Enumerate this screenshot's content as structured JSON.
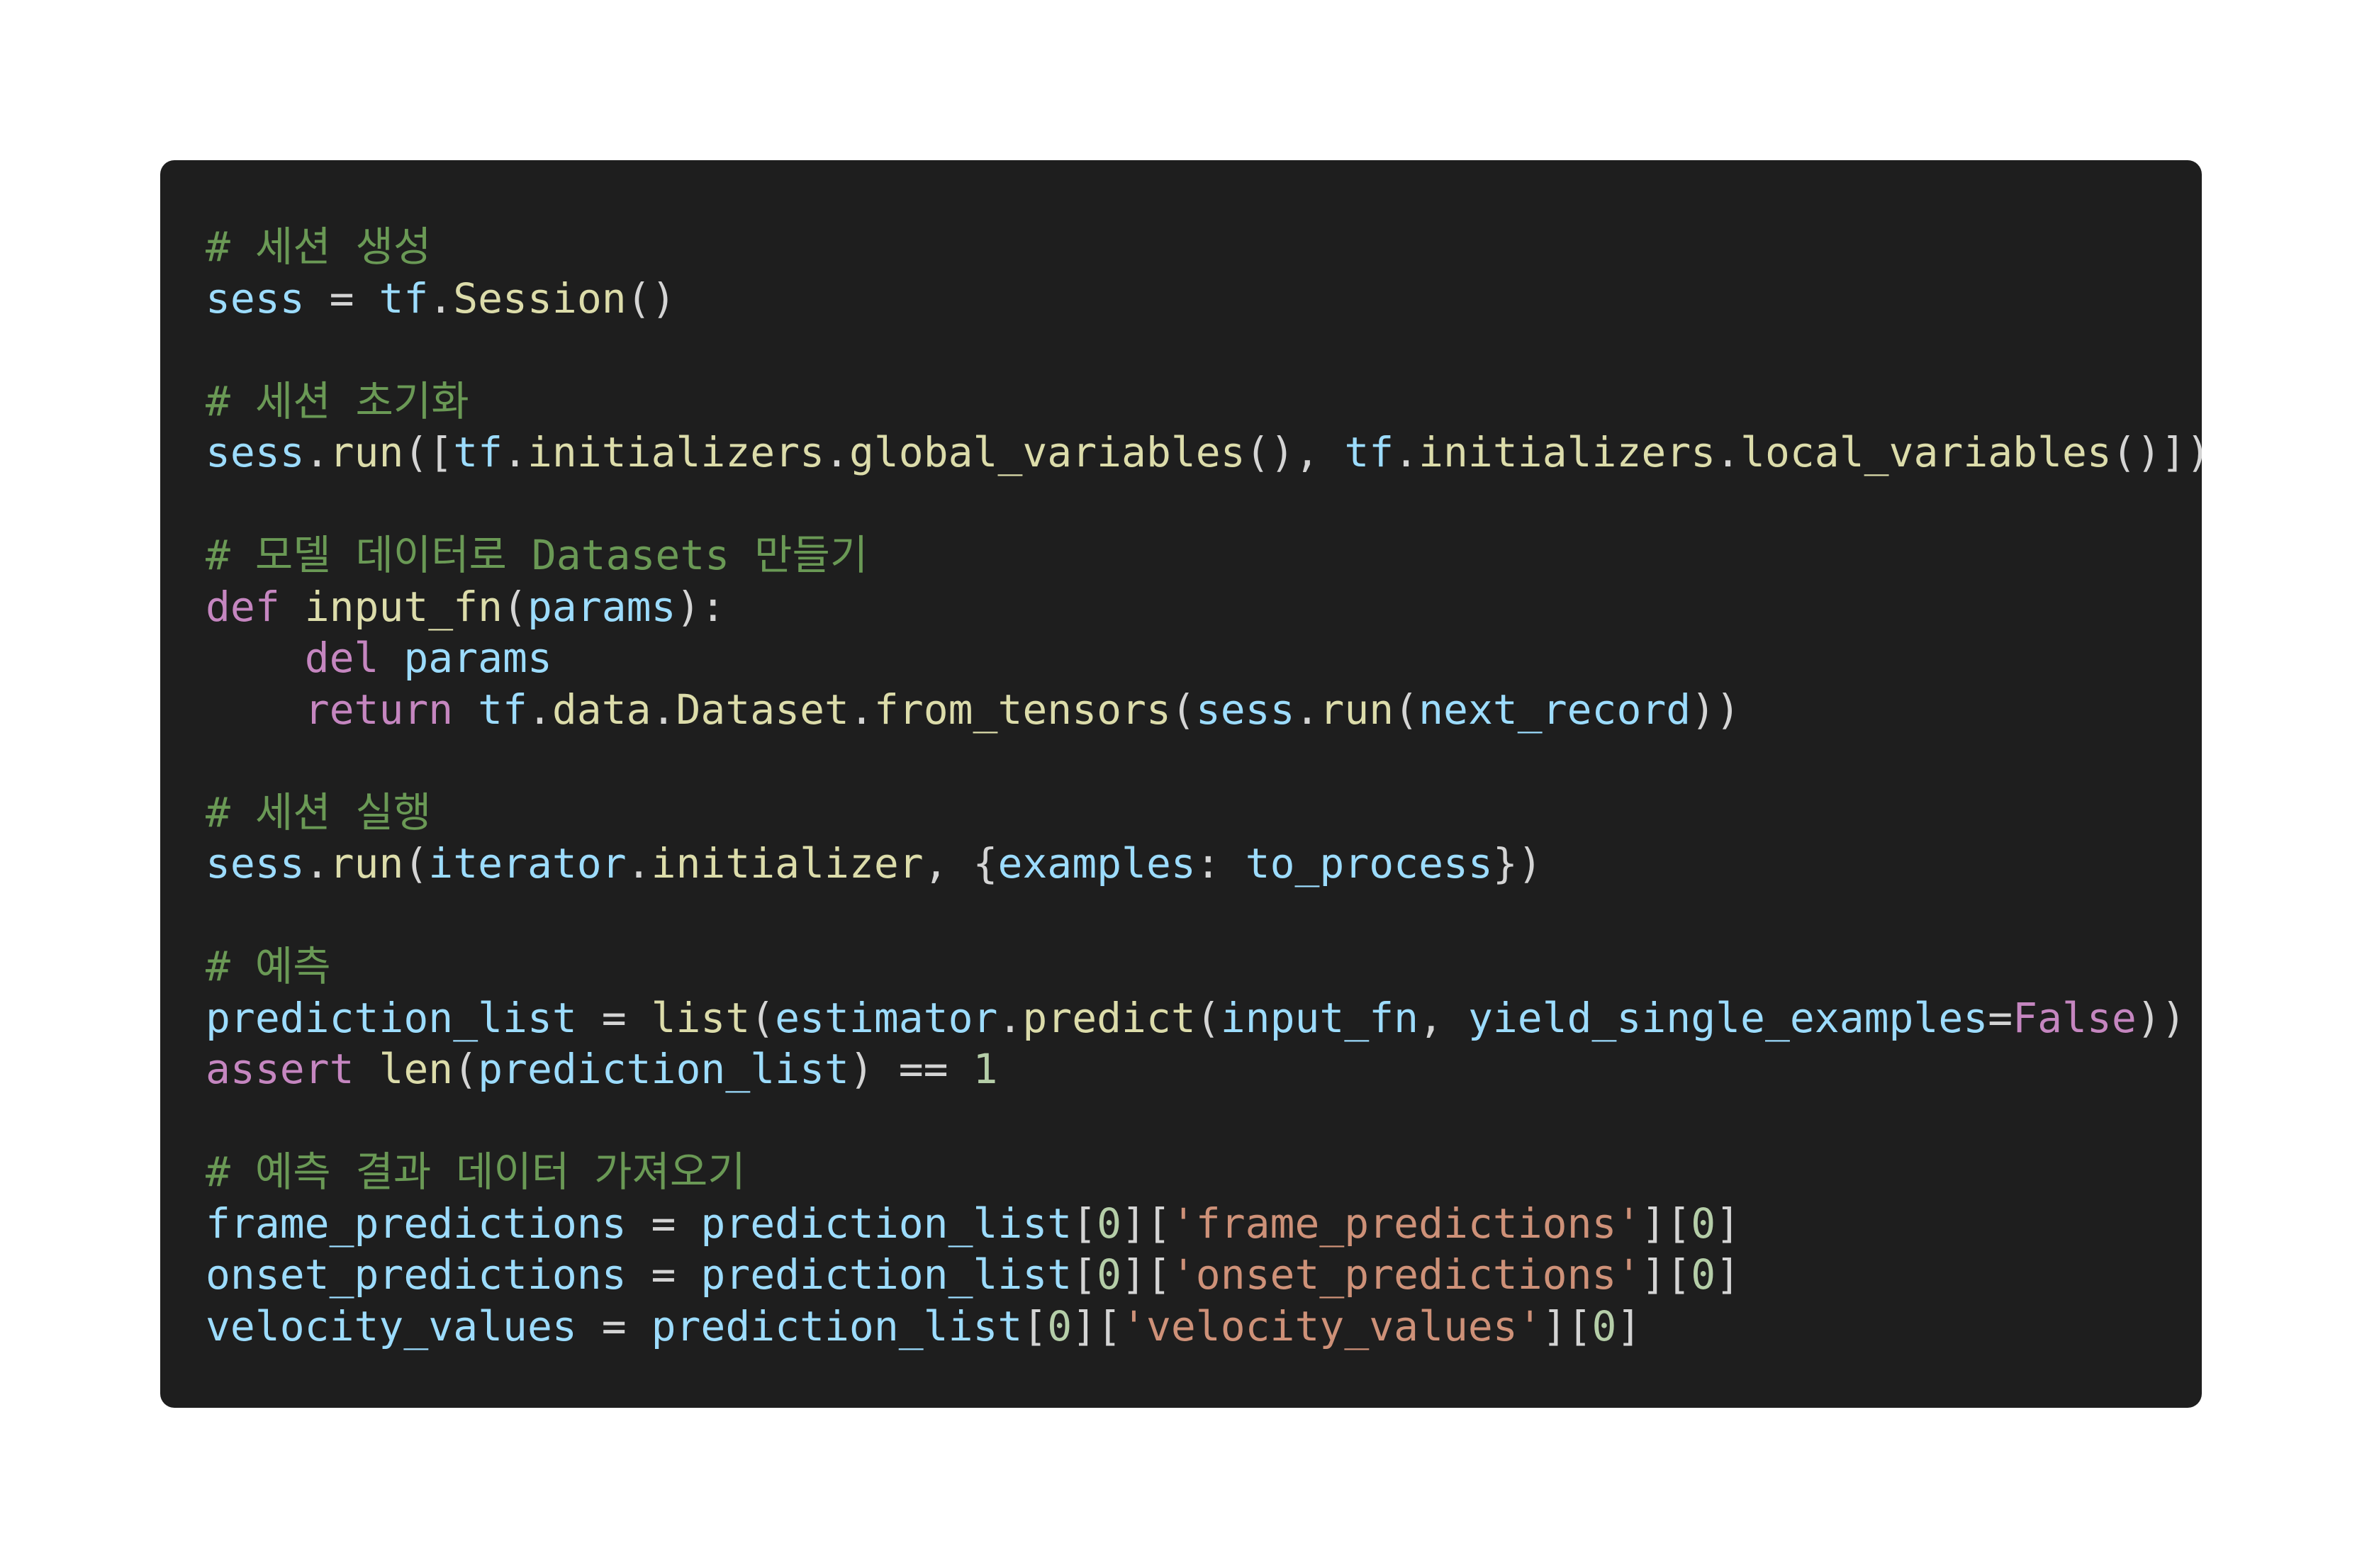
{
  "theme": {
    "background": "#ffffff",
    "card_background": "#1e1e1e",
    "comment": "#6a9955",
    "variable": "#9cdcfe",
    "function": "#dcdcaa",
    "keyword": "#c586c0",
    "string": "#ce9178",
    "number": "#b5cea8",
    "default": "#d4d4d4"
  },
  "code": {
    "language": "python",
    "lines": [
      [
        {
          "t": "comment",
          "v": "# 세션 생성"
        }
      ],
      [
        {
          "t": "var",
          "v": "sess"
        },
        {
          "t": "op",
          "v": " = "
        },
        {
          "t": "var",
          "v": "tf"
        },
        {
          "t": "op",
          "v": "."
        },
        {
          "t": "fn",
          "v": "Session"
        },
        {
          "t": "plain",
          "v": "()"
        }
      ],
      [],
      [
        {
          "t": "comment",
          "v": "# 세션 초기화"
        }
      ],
      [
        {
          "t": "var",
          "v": "sess"
        },
        {
          "t": "op",
          "v": "."
        },
        {
          "t": "fn",
          "v": "run"
        },
        {
          "t": "plain",
          "v": "(["
        },
        {
          "t": "var",
          "v": "tf"
        },
        {
          "t": "op",
          "v": "."
        },
        {
          "t": "fn",
          "v": "initializers"
        },
        {
          "t": "op",
          "v": "."
        },
        {
          "t": "fn",
          "v": "global_variables"
        },
        {
          "t": "plain",
          "v": "(), "
        },
        {
          "t": "var",
          "v": "tf"
        },
        {
          "t": "op",
          "v": "."
        },
        {
          "t": "fn",
          "v": "initializers"
        },
        {
          "t": "op",
          "v": "."
        },
        {
          "t": "fn",
          "v": "local_variables"
        },
        {
          "t": "plain",
          "v": "()])"
        }
      ],
      [],
      [
        {
          "t": "comment",
          "v": "# 모델 데이터로 Datasets 만들기"
        }
      ],
      [
        {
          "t": "kw",
          "v": "def"
        },
        {
          "t": "plain",
          "v": " "
        },
        {
          "t": "fn",
          "v": "input_fn"
        },
        {
          "t": "plain",
          "v": "("
        },
        {
          "t": "var",
          "v": "params"
        },
        {
          "t": "plain",
          "v": "):"
        }
      ],
      [
        {
          "t": "plain",
          "v": "    "
        },
        {
          "t": "kw",
          "v": "del"
        },
        {
          "t": "plain",
          "v": " "
        },
        {
          "t": "var",
          "v": "params"
        }
      ],
      [
        {
          "t": "plain",
          "v": "    "
        },
        {
          "t": "kw",
          "v": "return"
        },
        {
          "t": "plain",
          "v": " "
        },
        {
          "t": "var",
          "v": "tf"
        },
        {
          "t": "op",
          "v": "."
        },
        {
          "t": "fn",
          "v": "data"
        },
        {
          "t": "op",
          "v": "."
        },
        {
          "t": "fn",
          "v": "Dataset"
        },
        {
          "t": "op",
          "v": "."
        },
        {
          "t": "fn",
          "v": "from_tensors"
        },
        {
          "t": "plain",
          "v": "("
        },
        {
          "t": "var",
          "v": "sess"
        },
        {
          "t": "op",
          "v": "."
        },
        {
          "t": "fn",
          "v": "run"
        },
        {
          "t": "plain",
          "v": "("
        },
        {
          "t": "var",
          "v": "next_record"
        },
        {
          "t": "plain",
          "v": "))"
        }
      ],
      [],
      [
        {
          "t": "comment",
          "v": "# 세션 실행"
        }
      ],
      [
        {
          "t": "var",
          "v": "sess"
        },
        {
          "t": "op",
          "v": "."
        },
        {
          "t": "fn",
          "v": "run"
        },
        {
          "t": "plain",
          "v": "("
        },
        {
          "t": "var",
          "v": "iterator"
        },
        {
          "t": "op",
          "v": "."
        },
        {
          "t": "fn",
          "v": "initializer"
        },
        {
          "t": "plain",
          "v": ", {"
        },
        {
          "t": "var",
          "v": "examples"
        },
        {
          "t": "plain",
          "v": ": "
        },
        {
          "t": "var",
          "v": "to_process"
        },
        {
          "t": "plain",
          "v": "})"
        }
      ],
      [],
      [
        {
          "t": "comment",
          "v": "# 예측"
        }
      ],
      [
        {
          "t": "var",
          "v": "prediction_list"
        },
        {
          "t": "op",
          "v": " = "
        },
        {
          "t": "fn",
          "v": "list"
        },
        {
          "t": "plain",
          "v": "("
        },
        {
          "t": "var",
          "v": "estimator"
        },
        {
          "t": "op",
          "v": "."
        },
        {
          "t": "fn",
          "v": "predict"
        },
        {
          "t": "plain",
          "v": "("
        },
        {
          "t": "var",
          "v": "input_fn"
        },
        {
          "t": "plain",
          "v": ", "
        },
        {
          "t": "var",
          "v": "yield_single_examples"
        },
        {
          "t": "op",
          "v": "="
        },
        {
          "t": "kw",
          "v": "False"
        },
        {
          "t": "plain",
          "v": "))"
        }
      ],
      [
        {
          "t": "kw",
          "v": "assert"
        },
        {
          "t": "plain",
          "v": " "
        },
        {
          "t": "fn",
          "v": "len"
        },
        {
          "t": "plain",
          "v": "("
        },
        {
          "t": "var",
          "v": "prediction_list"
        },
        {
          "t": "plain",
          "v": ") "
        },
        {
          "t": "op",
          "v": "=="
        },
        {
          "t": "plain",
          "v": " "
        },
        {
          "t": "num",
          "v": "1"
        }
      ],
      [],
      [
        {
          "t": "comment",
          "v": "# 예측 결과 데이터 가져오기"
        }
      ],
      [
        {
          "t": "var",
          "v": "frame_predictions"
        },
        {
          "t": "op",
          "v": " = "
        },
        {
          "t": "var",
          "v": "prediction_list"
        },
        {
          "t": "plain",
          "v": "["
        },
        {
          "t": "num",
          "v": "0"
        },
        {
          "t": "plain",
          "v": "]["
        },
        {
          "t": "str",
          "v": "'frame_predictions'"
        },
        {
          "t": "plain",
          "v": "]["
        },
        {
          "t": "num",
          "v": "0"
        },
        {
          "t": "plain",
          "v": "]"
        }
      ],
      [
        {
          "t": "var",
          "v": "onset_predictions"
        },
        {
          "t": "op",
          "v": " = "
        },
        {
          "t": "var",
          "v": "prediction_list"
        },
        {
          "t": "plain",
          "v": "["
        },
        {
          "t": "num",
          "v": "0"
        },
        {
          "t": "plain",
          "v": "]["
        },
        {
          "t": "str",
          "v": "'onset_predictions'"
        },
        {
          "t": "plain",
          "v": "]["
        },
        {
          "t": "num",
          "v": "0"
        },
        {
          "t": "plain",
          "v": "]"
        }
      ],
      [
        {
          "t": "var",
          "v": "velocity_values"
        },
        {
          "t": "op",
          "v": " = "
        },
        {
          "t": "var",
          "v": "prediction_list"
        },
        {
          "t": "plain",
          "v": "["
        },
        {
          "t": "num",
          "v": "0"
        },
        {
          "t": "plain",
          "v": "]["
        },
        {
          "t": "str",
          "v": "'velocity_values'"
        },
        {
          "t": "plain",
          "v": "]["
        },
        {
          "t": "num",
          "v": "0"
        },
        {
          "t": "plain",
          "v": "]"
        }
      ]
    ]
  }
}
